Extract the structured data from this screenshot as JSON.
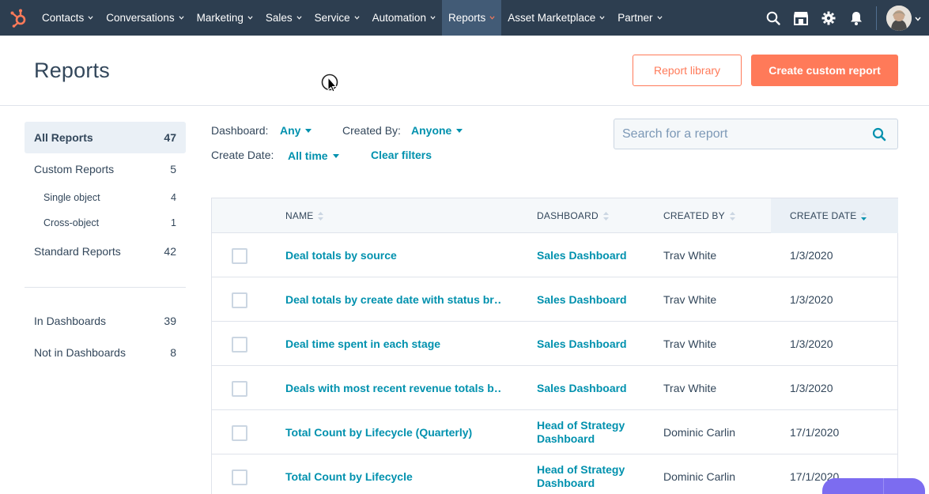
{
  "nav": {
    "items": [
      {
        "label": "Contacts",
        "active": false
      },
      {
        "label": "Conversations",
        "active": false
      },
      {
        "label": "Marketing",
        "active": false
      },
      {
        "label": "Sales",
        "active": false
      },
      {
        "label": "Service",
        "active": false
      },
      {
        "label": "Automation",
        "active": false
      },
      {
        "label": "Reports",
        "active": true
      },
      {
        "label": "Asset Marketplace",
        "active": false
      },
      {
        "label": "Partner",
        "active": false
      }
    ],
    "right_icons": [
      "search-icon",
      "marketplace-icon",
      "settings-icon",
      "notifications-icon"
    ]
  },
  "header": {
    "title": "Reports",
    "report_library": "Report library",
    "create_custom": "Create custom report"
  },
  "sidebar": {
    "all": {
      "label": "All Reports",
      "count": "47"
    },
    "custom": {
      "label": "Custom Reports",
      "count": "5"
    },
    "single": {
      "label": "Single object",
      "count": "4"
    },
    "cross": {
      "label": "Cross-object",
      "count": "1"
    },
    "standard": {
      "label": "Standard Reports",
      "count": "42"
    },
    "in_dash": {
      "label": "In Dashboards",
      "count": "39"
    },
    "not_in_dash": {
      "label": "Not in Dashboards",
      "count": "8"
    }
  },
  "filters": {
    "dashboard_label": "Dashboard:",
    "dashboard_value": "Any",
    "created_by_label": "Created By:",
    "created_by_value": "Anyone",
    "create_date_label": "Create Date:",
    "create_date_value": "All time",
    "clear": "Clear filters"
  },
  "search": {
    "placeholder": "Search for a report"
  },
  "table": {
    "headers": {
      "name": "NAME",
      "dashboard": "DASHBOARD",
      "created_by": "CREATED BY",
      "create_date": "CREATE DATE"
    },
    "rows": [
      {
        "name": "Deal totals by source",
        "dashboard": "Sales Dashboard",
        "created_by": "Trav White",
        "date": "1/3/2020"
      },
      {
        "name": "Deal totals by create date with status br…",
        "dashboard": "Sales Dashboard",
        "created_by": "Trav White",
        "date": "1/3/2020"
      },
      {
        "name": "Deal time spent in each stage",
        "dashboard": "Sales Dashboard",
        "created_by": "Trav White",
        "date": "1/3/2020"
      },
      {
        "name": "Deals with most recent revenue totals b…",
        "dashboard": "Sales Dashboard",
        "created_by": "Trav White",
        "date": "1/3/2020"
      },
      {
        "name": "Total Count by Lifecycle (Quarterly)",
        "dashboard": "Head of Strategy Dashboard",
        "created_by": "Dominic Carlin",
        "date": "17/1/2020"
      },
      {
        "name": "Total Count by Lifecycle",
        "dashboard": "Head of Strategy Dashboard",
        "created_by": "Dominic Carlin",
        "date": "17/1/2020"
      }
    ]
  },
  "colors": {
    "nav_bg": "#2d3e50",
    "accent_orange": "#ff7a59",
    "link_teal": "#0091ae",
    "text": "#33475b"
  }
}
